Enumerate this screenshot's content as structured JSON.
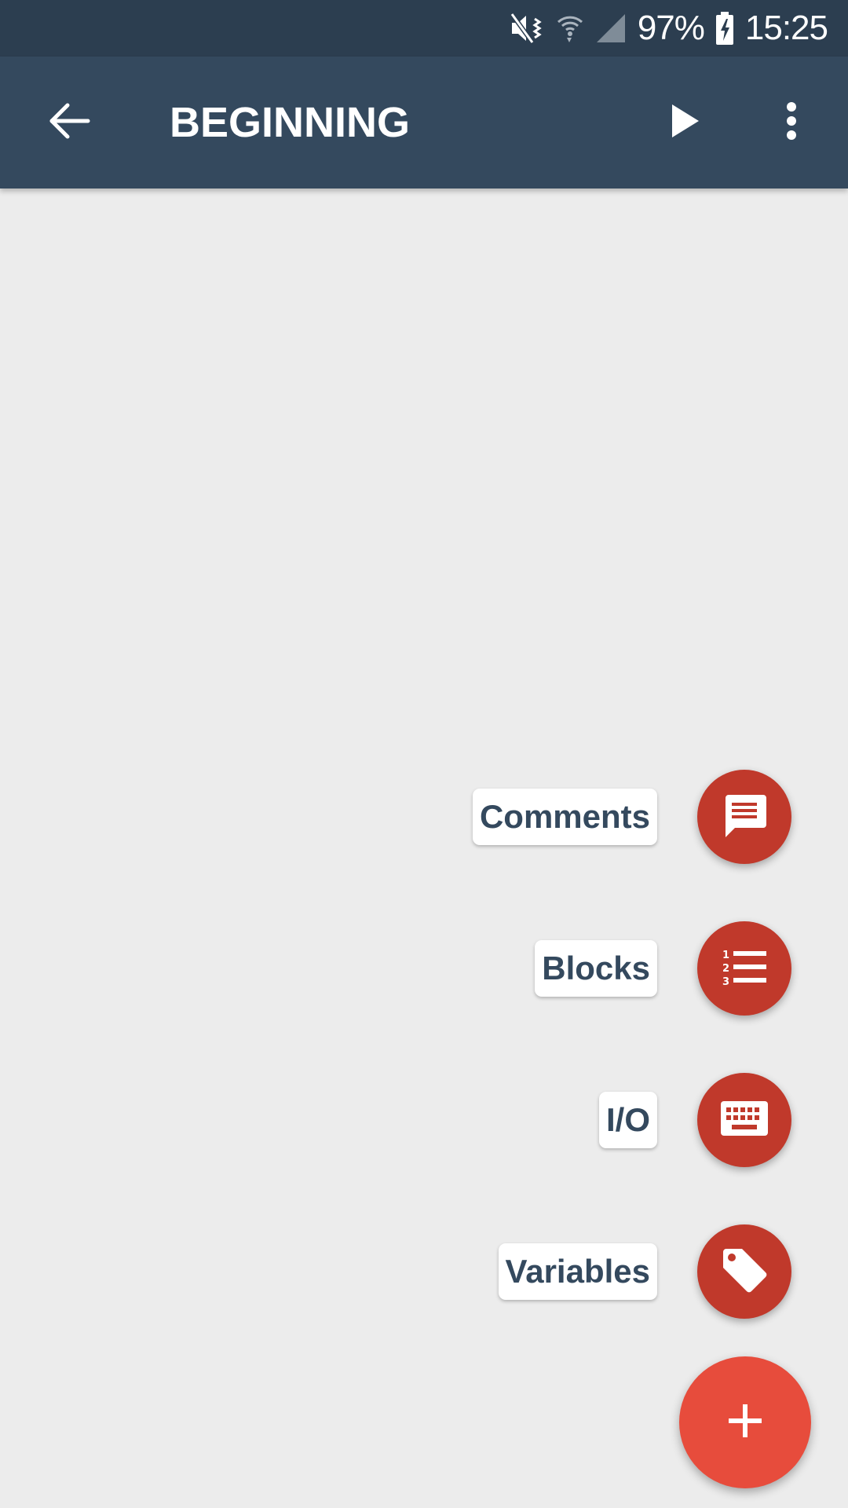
{
  "status_bar": {
    "battery": "97%",
    "time": "15:25",
    "icons": [
      "mute-vibrate-icon",
      "wifi-icon",
      "signal-icon",
      "battery-charging-icon"
    ]
  },
  "app_bar": {
    "title": "BEGINNING",
    "icons": [
      "back-arrow-icon",
      "play-icon",
      "more-vert-icon"
    ]
  },
  "fab_menu": {
    "items": [
      {
        "label": "Comments",
        "icon": "comment-icon"
      },
      {
        "label": "Blocks",
        "icon": "numbered-list-icon"
      },
      {
        "label": "I/O",
        "icon": "keyboard-icon"
      },
      {
        "label": "Variables",
        "icon": "tag-icon"
      }
    ],
    "main_icon": "plus-icon"
  },
  "colors": {
    "status_bar": "#2c3e50",
    "app_bar": "#34495e",
    "background": "#ececec",
    "mini_fab": "#c0392b",
    "main_fab": "#e74c3c",
    "label_text": "#34495e"
  }
}
